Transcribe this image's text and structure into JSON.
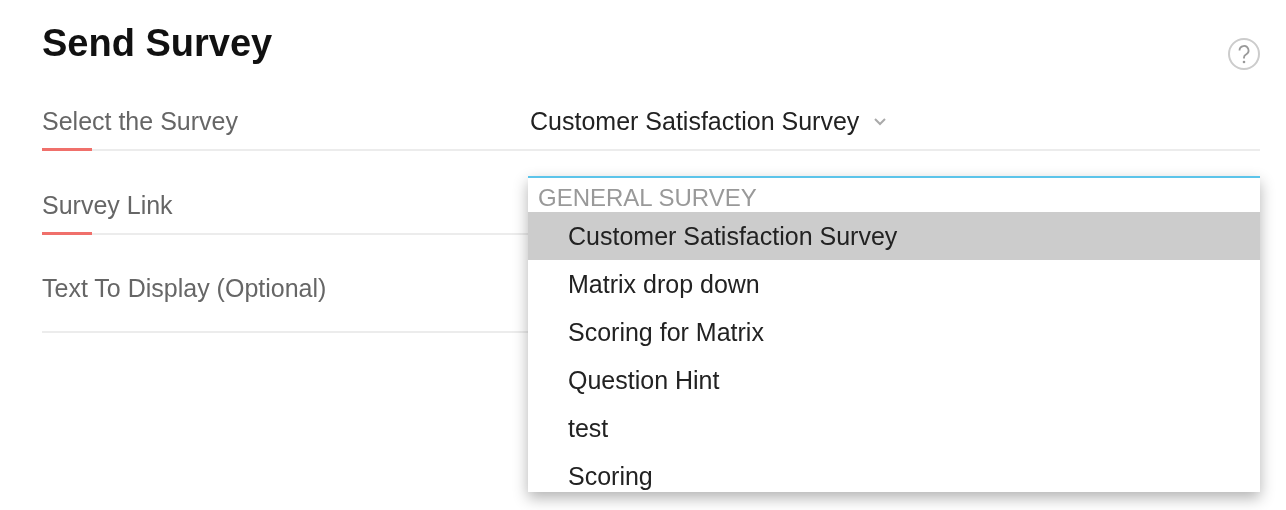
{
  "title": "Send Survey",
  "fields": [
    {
      "label": "Select the Survey",
      "required": true,
      "value": "Customer Satisfaction Survey"
    },
    {
      "label": "Survey Link",
      "required": true
    },
    {
      "label": "Text To Display (Optional)",
      "required": false
    }
  ],
  "dropdown": {
    "group": "GENERAL SURVEY",
    "options": [
      {
        "label": "Customer Satisfaction Survey",
        "selected": true
      },
      {
        "label": "Matrix drop down",
        "selected": false
      },
      {
        "label": "Scoring for Matrix",
        "selected": false
      },
      {
        "label": "Question Hint",
        "selected": false
      },
      {
        "label": "test",
        "selected": false
      },
      {
        "label": "Scoring",
        "selected": false
      }
    ]
  }
}
